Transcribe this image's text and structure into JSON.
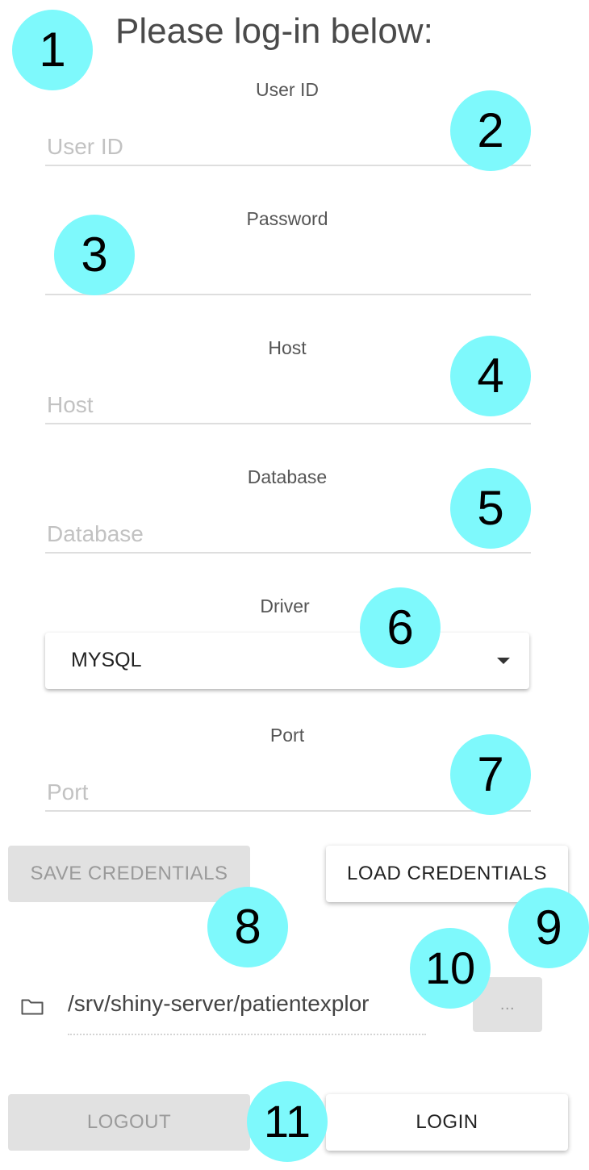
{
  "title": "Please log-in below:",
  "form": {
    "user_id": {
      "label": "User ID",
      "placeholder": "User ID"
    },
    "password": {
      "label": "Password"
    },
    "host": {
      "label": "Host",
      "placeholder": "Host"
    },
    "database": {
      "label": "Database",
      "placeholder": "Database"
    },
    "driver": {
      "label": "Driver",
      "value": "MYSQL"
    },
    "port": {
      "label": "Port",
      "placeholder": "Port"
    }
  },
  "buttons": {
    "save_credentials": "SAVE CREDENTIALS",
    "load_credentials": "LOAD CREDENTIALS",
    "browse": "...",
    "logout": "LOGOUT",
    "login": "LOGIN"
  },
  "file": {
    "path": "/srv/shiny-server/patientexplor",
    "icon": "folder-icon"
  },
  "badges": [
    "1",
    "2",
    "3",
    "4",
    "5",
    "6",
    "7",
    "8",
    "9",
    "10",
    "11"
  ],
  "colors": {
    "badge": "#7ef9fc",
    "disabled_button": "#e1e1e1"
  }
}
